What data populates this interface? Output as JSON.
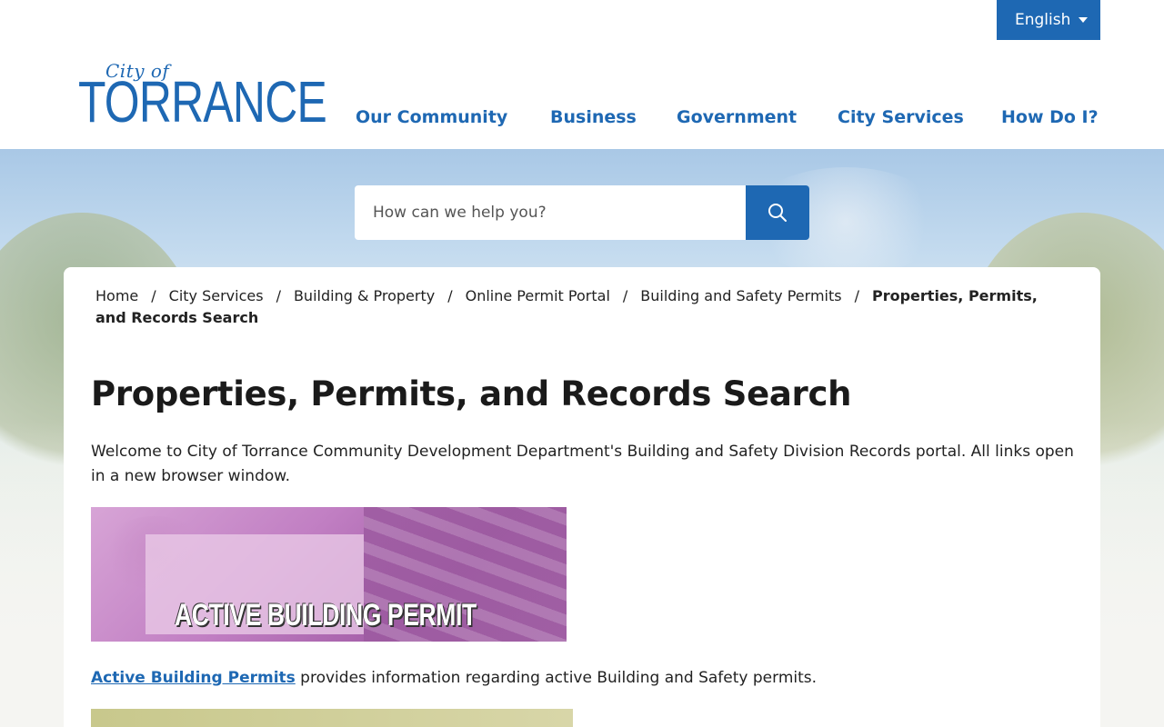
{
  "language": {
    "selected": "English"
  },
  "logo": {
    "line1": "City of",
    "line2": "TORRANCE"
  },
  "nav": [
    "Our Community",
    "Business",
    "Government",
    "City Services",
    "How Do I?"
  ],
  "search": {
    "placeholder": "How can we help you?"
  },
  "breadcrumb": {
    "items": [
      "Home",
      "City Services",
      "Building & Property",
      "Online Permit Portal",
      "Building and Safety Permits"
    ],
    "current": "Properties, Permits, and Records Search",
    "separator": "/"
  },
  "page": {
    "title": "Properties, Permits, and Records Search",
    "intro": "Welcome to City of Torrance Community Development Department's Building and Safety Division Records portal. All links open in a new browser window.",
    "banner_text": "ACTIVE BUILDING PERMIT",
    "link_text": "Active Building Permits",
    "link_desc": " provides information regarding active Building and Safety permits."
  },
  "colors": {
    "brand_blue": "#1e68b3",
    "banner_purple": "#b67cb9"
  },
  "icons": {
    "search": "search-icon",
    "language_caret": "caret-down-icon"
  }
}
